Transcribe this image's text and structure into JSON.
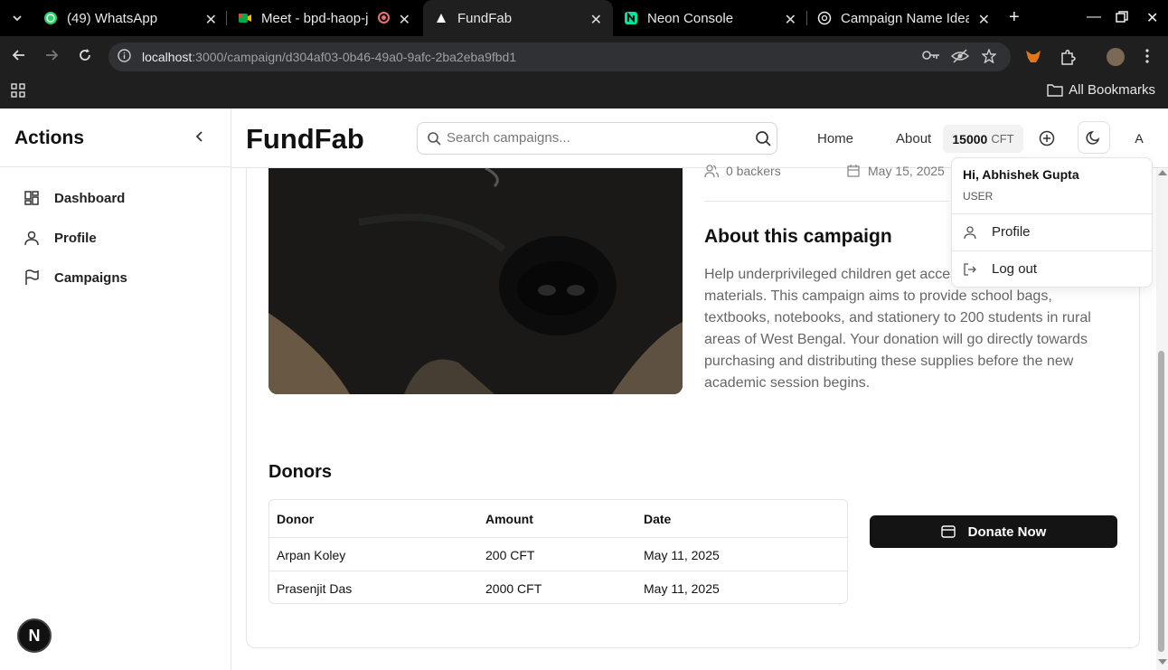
{
  "browser": {
    "tabs": [
      {
        "label": "(49) WhatsApp",
        "icon": "whatsapp-icon"
      },
      {
        "label": "Meet - bpd-haop-j",
        "icon": "google-meet-icon"
      },
      {
        "label": "FundFab",
        "icon": "triangle-icon"
      },
      {
        "label": "Neon Console",
        "icon": "neon-icon"
      },
      {
        "label": "Campaign Name Idea",
        "icon": "chatgpt-icon"
      }
    ],
    "url_host": "localhost",
    "url_path": ":3000/campaign/d304af03-0b46-49a0-9afc-2ba2eba9fbd1",
    "bookmarks_label": "All Bookmarks"
  },
  "sidebar": {
    "title": "Actions",
    "items": [
      {
        "label": "Dashboard",
        "icon": "dashboard-icon"
      },
      {
        "label": "Profile",
        "icon": "user-icon"
      },
      {
        "label": "Campaigns",
        "icon": "flag-icon"
      }
    ]
  },
  "header": {
    "brand": "FundFab",
    "search_placeholder": "Search campaigns...",
    "nav": [
      "Home",
      "About"
    ],
    "credits_value": "15000",
    "credits_unit": "CFT",
    "avatar_initial": "A"
  },
  "campaign": {
    "backers": "0 backers",
    "end_date": "May 15, 2025",
    "about_title": "About this campaign",
    "about_text": "Help underprivileged children get access to educational materials. This campaign aims to provide school bags, textbooks, notebooks, and stationery to 200 students in rural areas of West Bengal. Your donation will go directly towards purchasing and distributing these supplies before the new academic session begins."
  },
  "donors": {
    "title": "Donors",
    "columns": [
      "Donor",
      "Amount",
      "Date"
    ],
    "rows": [
      {
        "donor": "Arpan Koley",
        "amount": "200 CFT",
        "date": "May 11, 2025"
      },
      {
        "donor": "Prasenjit Das",
        "amount": "2000 CFT",
        "date": "May 11, 2025"
      }
    ]
  },
  "donate_label": "Donate Now",
  "user_menu": {
    "greeting": "Hi, Abhishek Gupta",
    "role": "USER",
    "items": [
      "Profile",
      "Log out"
    ]
  },
  "dev_badge": "N",
  "colors": {
    "primary": "#141414",
    "muted_text": "#666666",
    "border": "#e5e5e5"
  }
}
